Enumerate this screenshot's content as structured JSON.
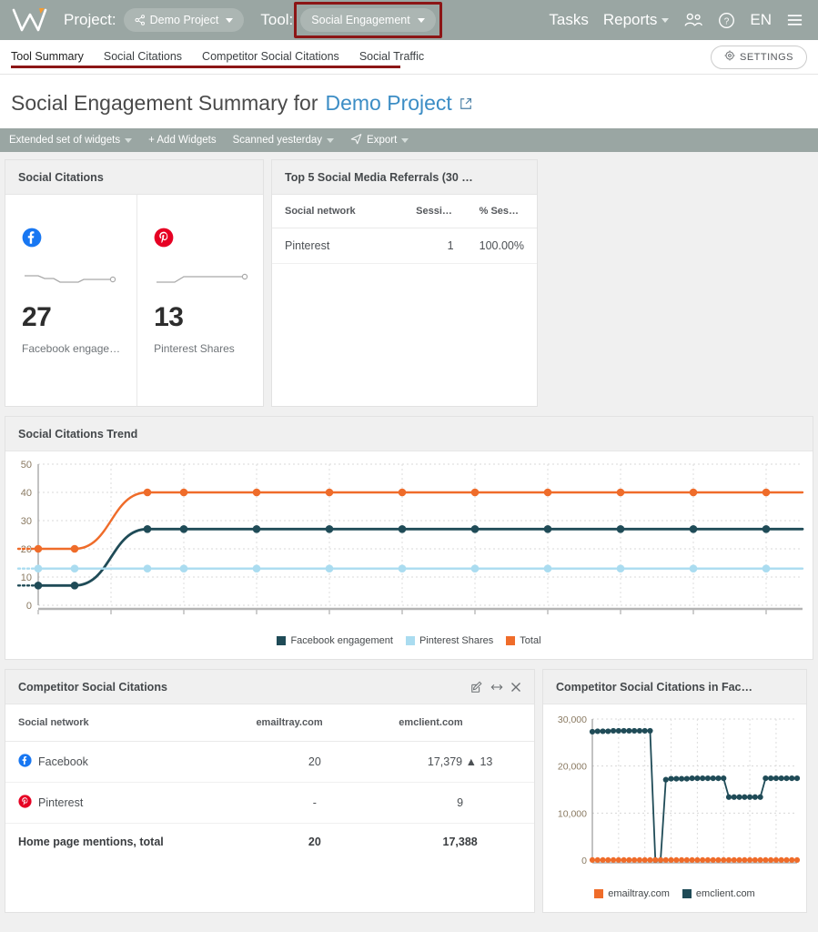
{
  "topbar": {
    "logo_name": "WebCEO",
    "project_label": "Project:",
    "project_value": "Demo Project",
    "tool_label": "Tool:",
    "tool_value": "Social Engagement",
    "tasks": "Tasks",
    "reports": "Reports",
    "lang": "EN"
  },
  "tabs": [
    {
      "label": "Tool Summary",
      "active": true
    },
    {
      "label": "Social Citations",
      "active": false
    },
    {
      "label": "Competitor Social Citations",
      "active": false
    },
    {
      "label": "Social Traffic",
      "active": false
    }
  ],
  "settings_button": "SETTINGS",
  "page": {
    "title_prefix": "Social Engagement Summary for",
    "title_project": "Demo Project"
  },
  "actionbar": {
    "widget_set": "Extended set of widgets",
    "add_widgets": "+ Add Widgets",
    "scanned": "Scanned yesterday",
    "export": "Export"
  },
  "social_citations": {
    "title": "Social Citations",
    "cells": [
      {
        "network": "facebook",
        "value": "27",
        "caption": "Facebook engage…"
      },
      {
        "network": "pinterest",
        "value": "13",
        "caption": "Pinterest Shares"
      }
    ]
  },
  "referrals": {
    "title": "Top 5 Social Media Referrals (30 …",
    "columns": [
      "Social network",
      "Sessi…",
      "% Ses…"
    ],
    "rows": [
      [
        "Pinterest",
        "1",
        "100.00%"
      ]
    ]
  },
  "competitor_table": {
    "title": "Competitor Social Citations",
    "columns": [
      "Social network",
      "emailtray.com",
      "emclient.com"
    ],
    "rows": [
      {
        "network": "Facebook",
        "icon": "facebook",
        "emailtray": "20",
        "emclient": "17,379",
        "emclient_delta": "13",
        "emclient_green": true
      },
      {
        "network": "Pinterest",
        "icon": "pinterest",
        "emailtray": "-",
        "emclient": "9",
        "emclient_delta": "",
        "emclient_green": true
      }
    ],
    "total_row": {
      "label": "Home page mentions, total",
      "emailtray": "20",
      "emclient": "17,388"
    }
  },
  "colors": {
    "facebook_blue": "#1877F2",
    "pinterest_red": "#E60023",
    "series_dark_teal": "#1f4b57",
    "series_light_blue": "#aadcf0",
    "series_orange": "#ef6c2a",
    "accent_green": "#48a648",
    "brand_bar": "#9aa6a3",
    "link_blue": "#3c8dc5",
    "annotation_red": "#8c1616"
  },
  "chart_data": [
    {
      "type": "line",
      "title": "Social Citations Trend",
      "xlabel": "",
      "ylabel": "",
      "ylim": [
        0,
        50
      ],
      "yticks": [
        0,
        10,
        20,
        30,
        40,
        50
      ],
      "grid": true,
      "legend_position": "bottom",
      "x": [
        1,
        2,
        3,
        4,
        5,
        6,
        7,
        8,
        9,
        10,
        11,
        12,
        13,
        14,
        15,
        16,
        17,
        18,
        19,
        20,
        21,
        22
      ],
      "series": [
        {
          "name": "Facebook engagement",
          "color": "#1f4b57",
          "values": [
            7,
            7,
            null,
            27,
            27,
            27,
            27,
            27,
            27,
            27,
            27,
            27,
            27,
            27,
            27,
            27,
            27,
            27,
            27,
            27,
            27,
            27
          ]
        },
        {
          "name": "Pinterest Shares",
          "color": "#aadcf0",
          "values": [
            13,
            13,
            null,
            13,
            13,
            13,
            13,
            13,
            13,
            13,
            13,
            13,
            13,
            13,
            13,
            13,
            13,
            13,
            13,
            13,
            13,
            13
          ]
        },
        {
          "name": "Total",
          "color": "#ef6c2a",
          "values": [
            20,
            20,
            null,
            40,
            40,
            40,
            40,
            40,
            40,
            40,
            40,
            40,
            40,
            40,
            40,
            40,
            40,
            40,
            40,
            40,
            40,
            40
          ]
        }
      ]
    },
    {
      "type": "line",
      "title": "Competitor Social Citations in Fac…",
      "xlabel": "",
      "ylabel": "",
      "ylim": [
        0,
        30000
      ],
      "yticks": [
        0,
        10000,
        20000,
        30000
      ],
      "ytick_labels": [
        "0",
        "10,000",
        "20,000",
        "30,000"
      ],
      "grid": true,
      "legend_position": "bottom",
      "series": [
        {
          "name": "emailtray.com",
          "color": "#ef6c2a",
          "values": [
            20,
            20,
            20,
            20,
            20,
            20,
            20,
            20,
            20,
            20,
            20,
            20,
            20,
            20,
            20,
            20,
            20,
            20,
            20,
            20,
            20,
            20,
            20,
            20,
            20,
            20,
            20,
            20,
            20,
            20,
            20,
            20,
            20,
            20,
            20,
            20,
            20,
            20,
            20,
            20
          ]
        },
        {
          "name": "emclient.com",
          "color": "#1f4b57",
          "values": [
            27300,
            27400,
            27400,
            27400,
            27500,
            27500,
            27500,
            27500,
            27500,
            27500,
            27500,
            27500,
            0,
            0,
            17100,
            17300,
            17300,
            17300,
            17300,
            17400,
            17400,
            17400,
            17400,
            17400,
            17400,
            17400,
            13400,
            13400,
            13400,
            13400,
            13400,
            13400,
            13400,
            17400,
            17400,
            17400,
            17400,
            17400,
            17400,
            17400
          ]
        }
      ]
    }
  ]
}
